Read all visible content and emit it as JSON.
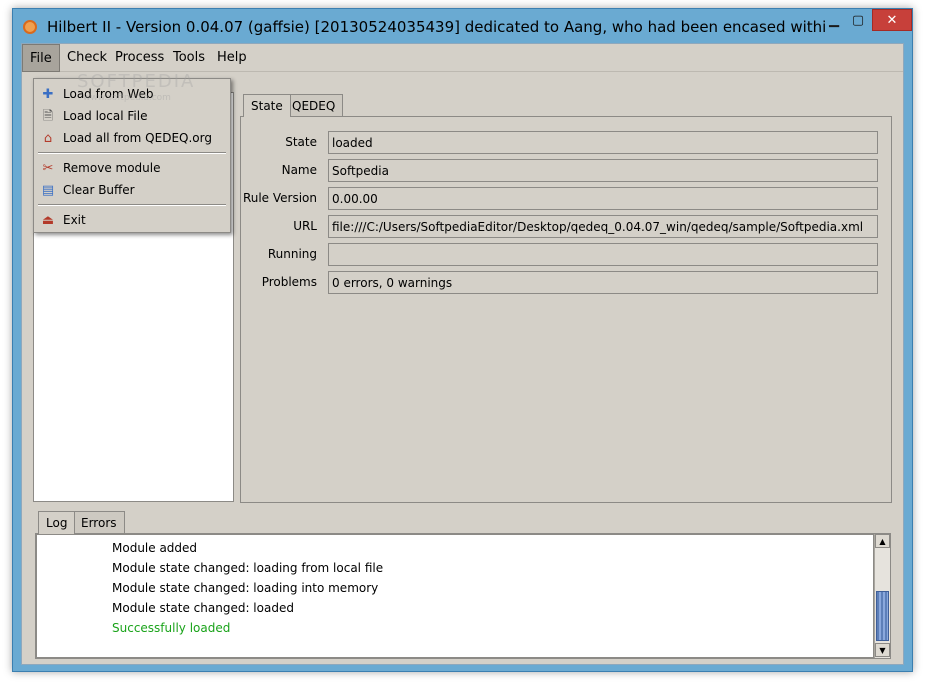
{
  "window": {
    "title": "Hilbert II - Version 0.04.07 (gaffsie) [20130524035439] dedicated to Aang, who had been encased within a sphere ...",
    "controls": {
      "minimize": "▁",
      "maximize": "▢",
      "close": "✕"
    }
  },
  "menubar": {
    "file": "File",
    "check": "Check",
    "process": "Process",
    "tools": "Tools",
    "help": "Help"
  },
  "file_menu": {
    "items": [
      {
        "label": "Load from Web",
        "icon": "plus-icon"
      },
      {
        "label": "Load local File",
        "icon": "document-icon"
      },
      {
        "label": "Load all from QEDEQ.org",
        "icon": "home-icon"
      },
      {
        "label": "Remove module",
        "icon": "scissors-icon"
      },
      {
        "label": "Clear Buffer",
        "icon": "printer-icon"
      },
      {
        "label": "Exit",
        "icon": "exit-icon"
      }
    ]
  },
  "watermark": {
    "text": "SOFTPEDIA",
    "sub": "www.softpedia.com"
  },
  "tabs_top": {
    "state": "State",
    "qedeq": "QEDEQ"
  },
  "state_panel": {
    "fields": [
      {
        "label": "State",
        "value": "loaded"
      },
      {
        "label": "Name",
        "value": "Softpedia"
      },
      {
        "label": "Rule Version",
        "value": "0.00.00"
      },
      {
        "label": "URL",
        "value": "file:///C:/Users/SoftpediaEditor/Desktop/qedeq_0.04.07_win/qedeq/sample/Softpedia.xml"
      },
      {
        "label": "Running",
        "value": ""
      },
      {
        "label": "Problems",
        "value": "0 errors, 0 warnings"
      }
    ]
  },
  "tabs_bottom": {
    "log": "Log",
    "errors": "Errors"
  },
  "log": {
    "lines": [
      "Module added",
      "Module state changed: loading from local file",
      "Module state changed: loading into memory",
      "Module state changed: loaded",
      "Successfully loaded"
    ],
    "success_color": "#1aa31a"
  }
}
